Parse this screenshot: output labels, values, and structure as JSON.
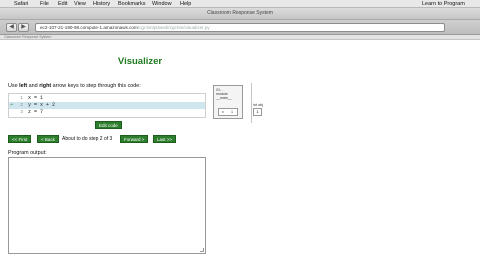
{
  "menubar": {
    "apple": "",
    "items": [
      "Safari",
      "File",
      "Edit",
      "View",
      "History",
      "Bookmarks",
      "Window",
      "Help"
    ],
    "right_text": "Learn to Program"
  },
  "window": {
    "title": "Classroom Response System"
  },
  "toolbar": {
    "back": "◀",
    "forward": "▶",
    "url_main": "ec2-107-21-190-98.compute-1.amazonaws.com",
    "url_faded": "/cgi-bin/ptsweb/cgi-bin/visualizer.py"
  },
  "tabbar": {
    "text": "Classroom Response System"
  },
  "page": {
    "title": "Visualizer",
    "instructions_prefix": "Use ",
    "instructions_left": "left",
    "instructions_mid": " and ",
    "instructions_right": "right",
    "instructions_suffix": " arrow keys to step through this code:"
  },
  "code": {
    "lines": [
      {
        "no": "1",
        "text": "x = 1"
      },
      {
        "no": "2",
        "text": "y = x + 2"
      },
      {
        "no": "3",
        "text": "z = 7"
      }
    ],
    "arrow": "➔"
  },
  "buttons": {
    "edit": "Edit code",
    "first": "<< First",
    "back": "< Back",
    "step_text": "About to do step 2 of 3",
    "forward": "Forward >",
    "last": "Last >>"
  },
  "output": {
    "label": "Program output:",
    "value": ""
  },
  "frames": {
    "title": "Gl...\nmodule\n__main__",
    "cell_a": "x",
    "cell_b": "1",
    "obj_label": "int obj",
    "obj_value": "1"
  }
}
